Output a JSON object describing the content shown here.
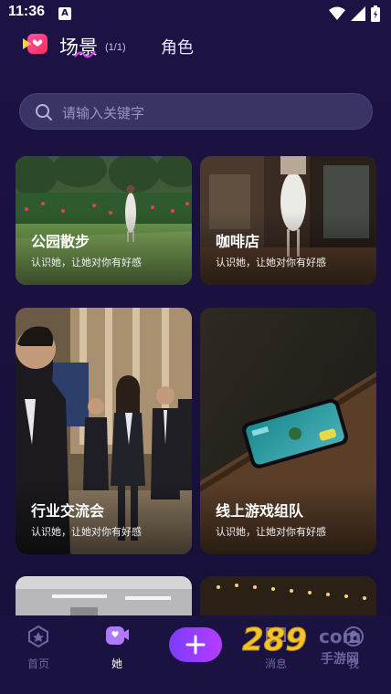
{
  "status": {
    "time": "11:36",
    "notif_letter": "A"
  },
  "header": {
    "title": "场景",
    "count": "(1/1)",
    "role_tab": "角色"
  },
  "search": {
    "placeholder": "请输入关键字"
  },
  "cards": [
    {
      "title": "公园散步",
      "subtitle": "认识她，让她对你有好感"
    },
    {
      "title": "咖啡店",
      "subtitle": "认识她，让她对你有好感"
    },
    {
      "title": "行业交流会",
      "subtitle": "认识她，让她对你有好感"
    },
    {
      "title": "线上游戏组队",
      "subtitle": "认识她，让她对你有好感"
    }
  ],
  "nav": {
    "home": "首页",
    "her": "她",
    "messages": "消息",
    "me": "我"
  },
  "watermark": {
    "number": "289",
    "suffix": "com",
    "text": "手游网"
  },
  "colors": {
    "accent": "#9b3cff",
    "bg": "#1d1244"
  }
}
